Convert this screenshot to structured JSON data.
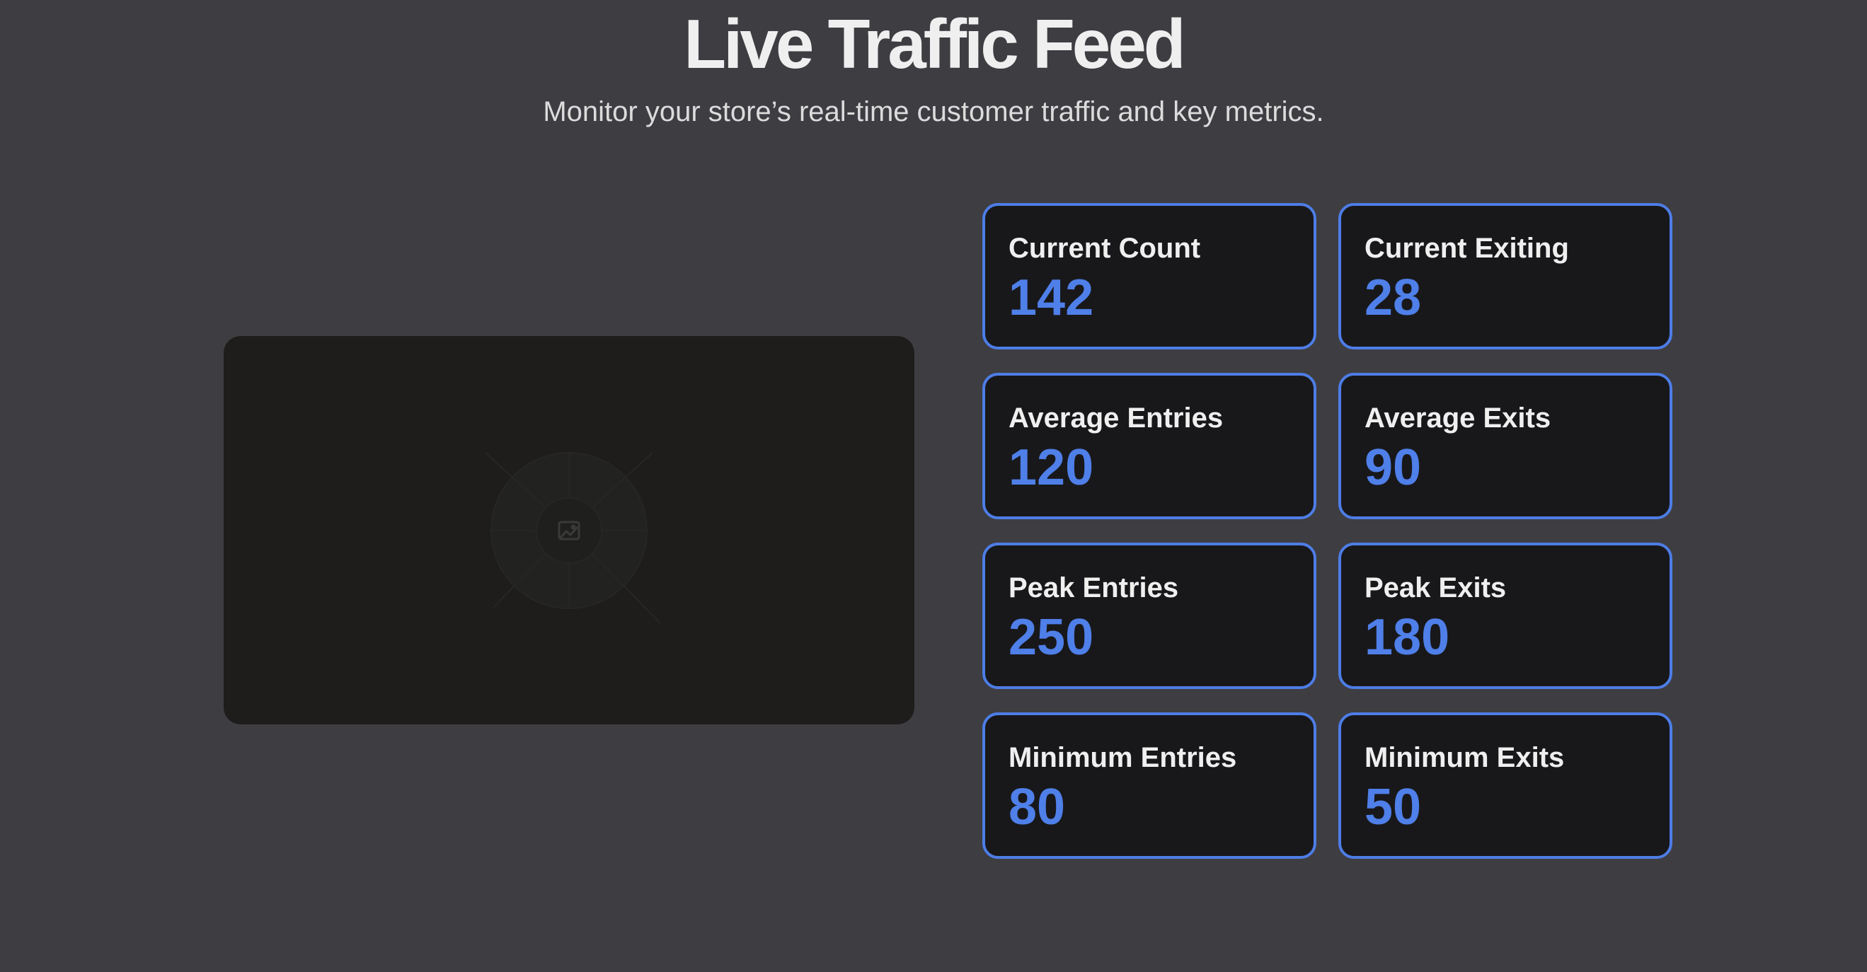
{
  "header": {
    "title": "Live Traffic Feed",
    "subtitle": "Monitor your store’s real-time customer traffic and key metrics."
  },
  "feed": {
    "icon": "image-placeholder-icon"
  },
  "metrics": [
    {
      "label": "Current Count",
      "value": "142"
    },
    {
      "label": "Current Exiting",
      "value": "28"
    },
    {
      "label": "Average Entries",
      "value": "120"
    },
    {
      "label": "Average Exits",
      "value": "90"
    },
    {
      "label": "Peak Entries",
      "value": "250"
    },
    {
      "label": "Peak Exits",
      "value": "180"
    },
    {
      "label": "Minimum Entries",
      "value": "80"
    },
    {
      "label": "Minimum Exits",
      "value": "50"
    }
  ],
  "colors": {
    "background": "#3e3d42",
    "card_background": "#18181b",
    "accent": "#4f7fe8",
    "feed_background": "#1e1d1c"
  }
}
